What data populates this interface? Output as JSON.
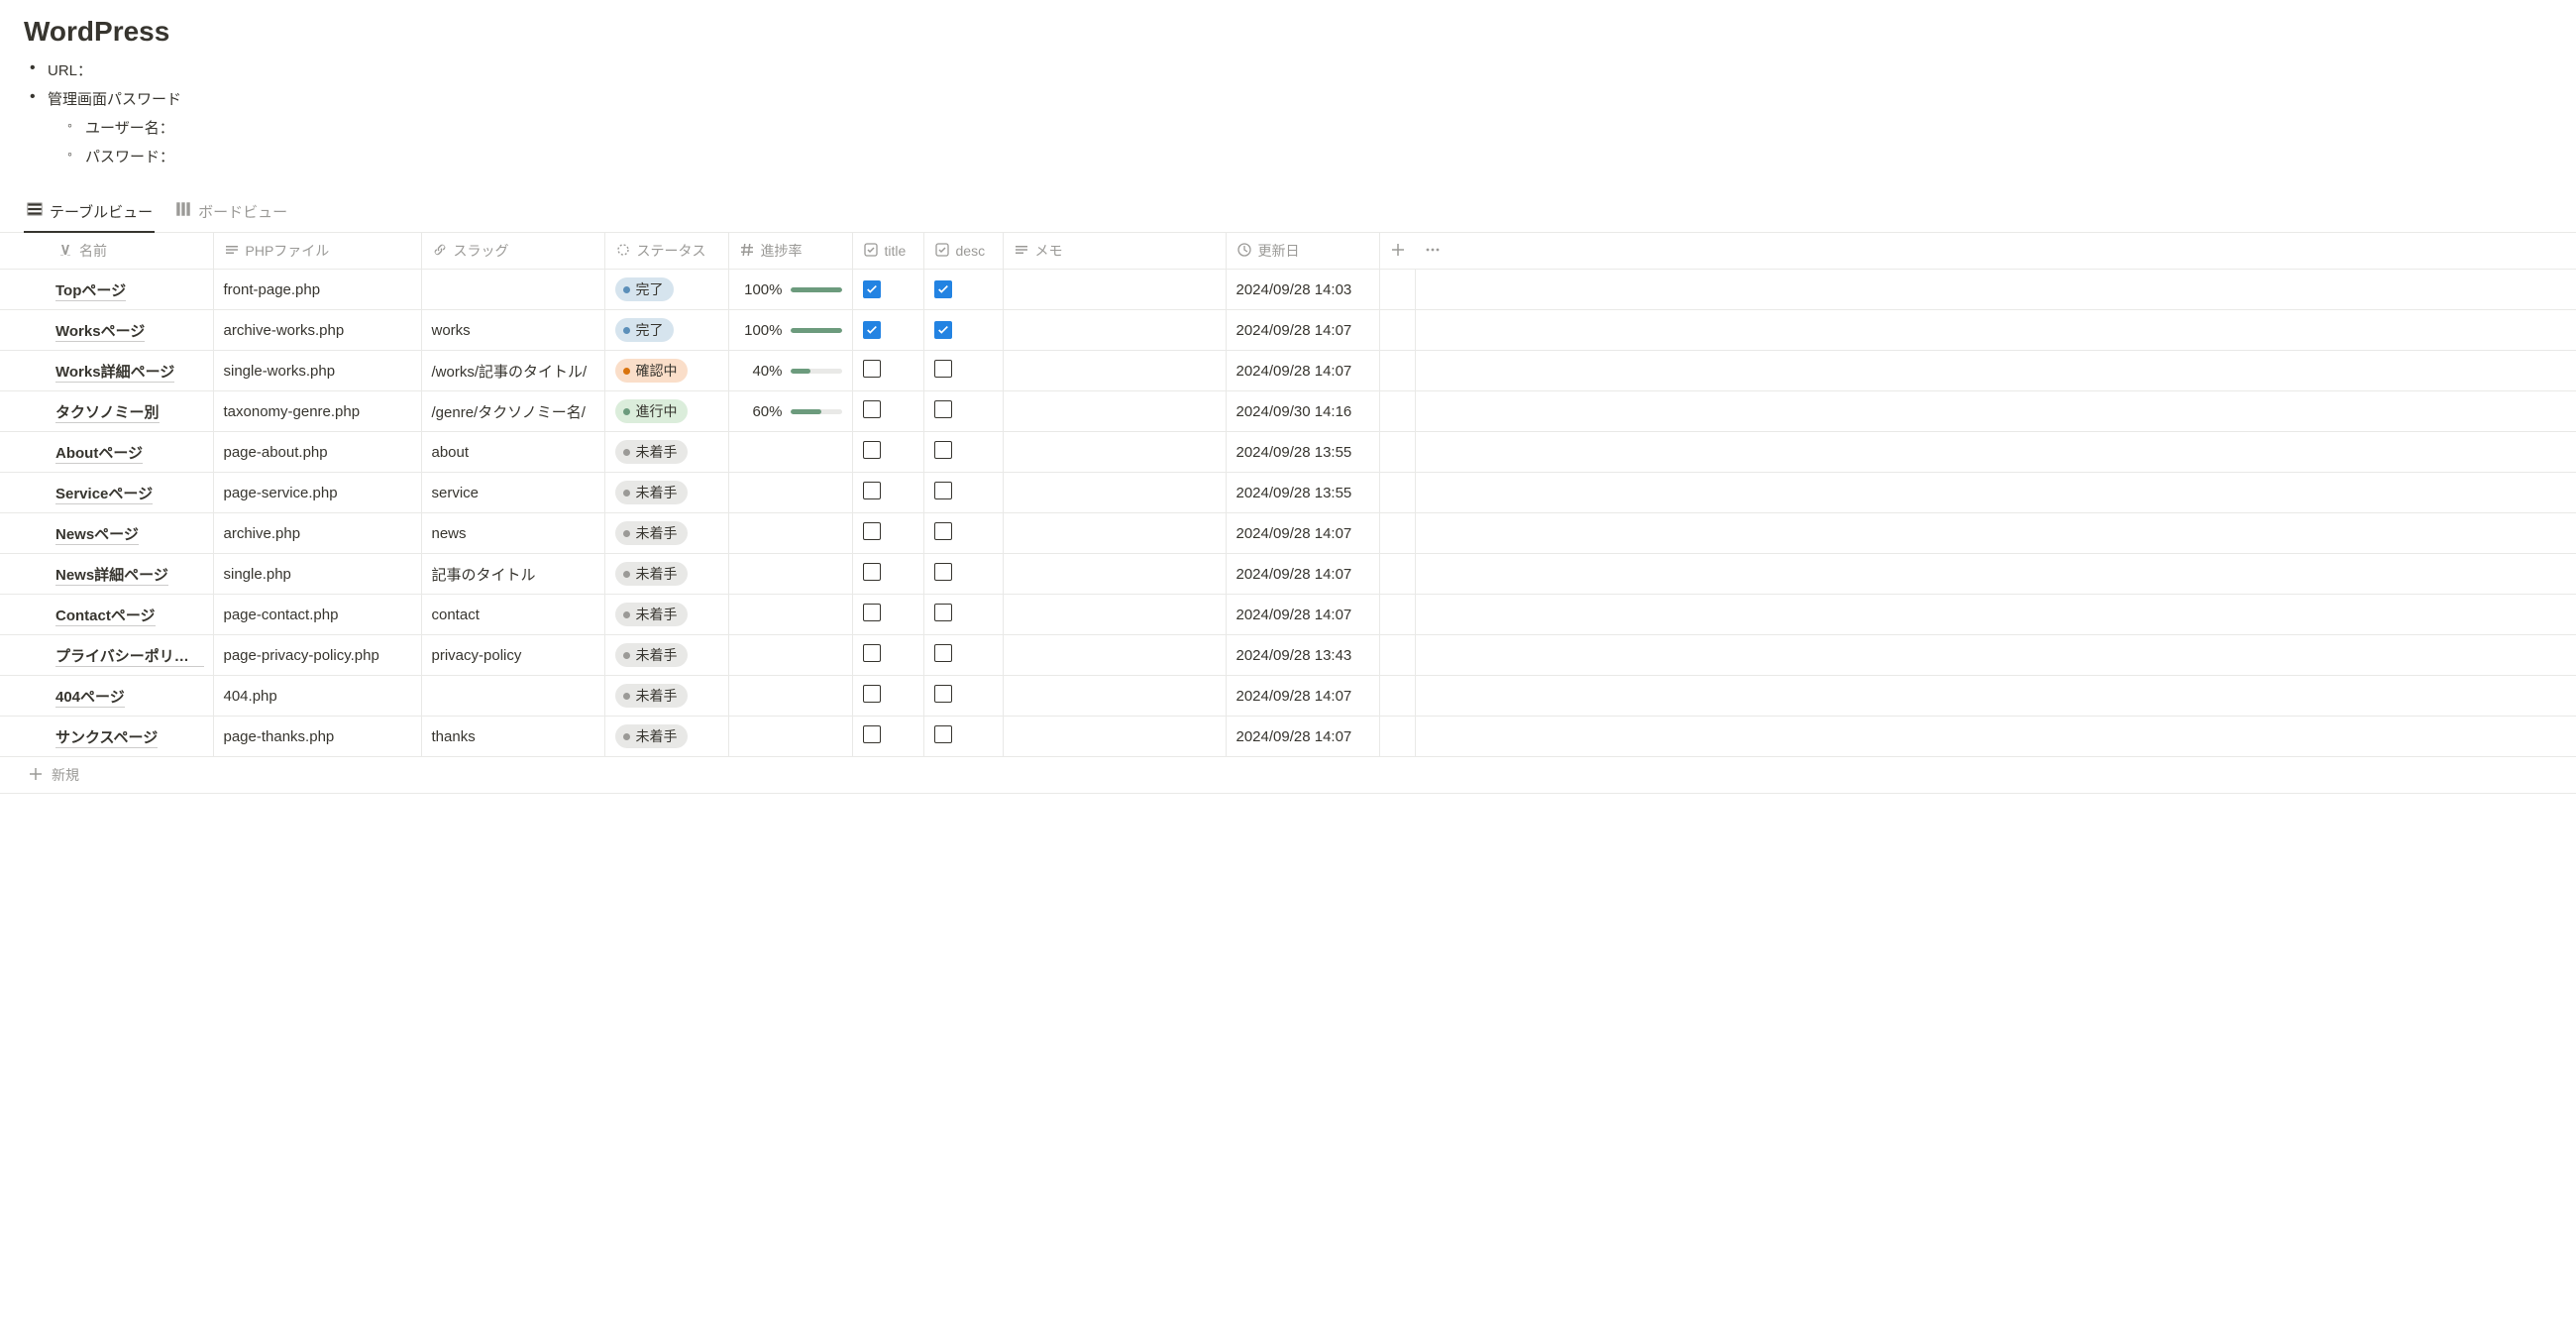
{
  "title": "WordPress",
  "bullets": {
    "url": "URL：",
    "admin_pw": "管理画面パスワード",
    "username": "ユーザー名：",
    "password": "パスワード："
  },
  "tabs": {
    "table_view": "テーブルビュー",
    "board_view": "ボードビュー"
  },
  "columns": {
    "name": "名前",
    "php": "PHPファイル",
    "slug": "スラッグ",
    "status": "ステータス",
    "progress": "進捗率",
    "title": "title",
    "desc": "desc",
    "memo": "メモ",
    "updated": "更新日"
  },
  "status_labels": {
    "done": "完了",
    "confirm": "確認中",
    "prog": "進行中",
    "todo": "未着手"
  },
  "rows": [
    {
      "name": "Topページ",
      "php": "front-page.php",
      "slug": "",
      "status": "done",
      "progress": 100,
      "title": true,
      "desc": true,
      "memo": "",
      "updated": "2024/09/28 14:03"
    },
    {
      "name": "Worksページ",
      "php": "archive-works.php",
      "slug": "works",
      "status": "done",
      "progress": 100,
      "title": true,
      "desc": true,
      "memo": "",
      "updated": "2024/09/28 14:07"
    },
    {
      "name": "Works詳細ページ",
      "php": "single-works.php",
      "slug": "/works/記事のタイトル/",
      "status": "confirm",
      "progress": 40,
      "title": false,
      "desc": false,
      "memo": "",
      "updated": "2024/09/28 14:07"
    },
    {
      "name": "タクソノミー別",
      "php": "taxonomy-genre.php",
      "slug": "/genre/タクソノミー名/",
      "status": "prog",
      "progress": 60,
      "title": false,
      "desc": false,
      "memo": "",
      "updated": "2024/09/30 14:16"
    },
    {
      "name": "Aboutページ",
      "php": "page-about.php",
      "slug": "about",
      "status": "todo",
      "progress": null,
      "title": false,
      "desc": false,
      "memo": "",
      "updated": "2024/09/28 13:55"
    },
    {
      "name": "Serviceページ",
      "php": "page-service.php",
      "slug": "service",
      "status": "todo",
      "progress": null,
      "title": false,
      "desc": false,
      "memo": "",
      "updated": "2024/09/28 13:55"
    },
    {
      "name": "Newsページ",
      "php": "archive.php",
      "slug": "news",
      "status": "todo",
      "progress": null,
      "title": false,
      "desc": false,
      "memo": "",
      "updated": "2024/09/28 14:07"
    },
    {
      "name": "News詳細ページ",
      "php": "single.php",
      "slug": "記事のタイトル",
      "status": "todo",
      "progress": null,
      "title": false,
      "desc": false,
      "memo": "",
      "updated": "2024/09/28 14:07"
    },
    {
      "name": "Contactページ",
      "php": "page-contact.php",
      "slug": "contact",
      "status": "todo",
      "progress": null,
      "title": false,
      "desc": false,
      "memo": "",
      "updated": "2024/09/28 14:07"
    },
    {
      "name": "プライバシーポリシー",
      "php": "page-privacy-policy.php",
      "slug": "privacy-policy",
      "status": "todo",
      "progress": null,
      "title": false,
      "desc": false,
      "memo": "",
      "updated": "2024/09/28 13:43"
    },
    {
      "name": "404ページ",
      "php": "404.php",
      "slug": "",
      "status": "todo",
      "progress": null,
      "title": false,
      "desc": false,
      "memo": "",
      "updated": "2024/09/28 14:07"
    },
    {
      "name": "サンクスページ",
      "php": "page-thanks.php",
      "slug": "thanks",
      "status": "todo",
      "progress": null,
      "title": false,
      "desc": false,
      "memo": "",
      "updated": "2024/09/28 14:07"
    }
  ],
  "new_row": "新規"
}
